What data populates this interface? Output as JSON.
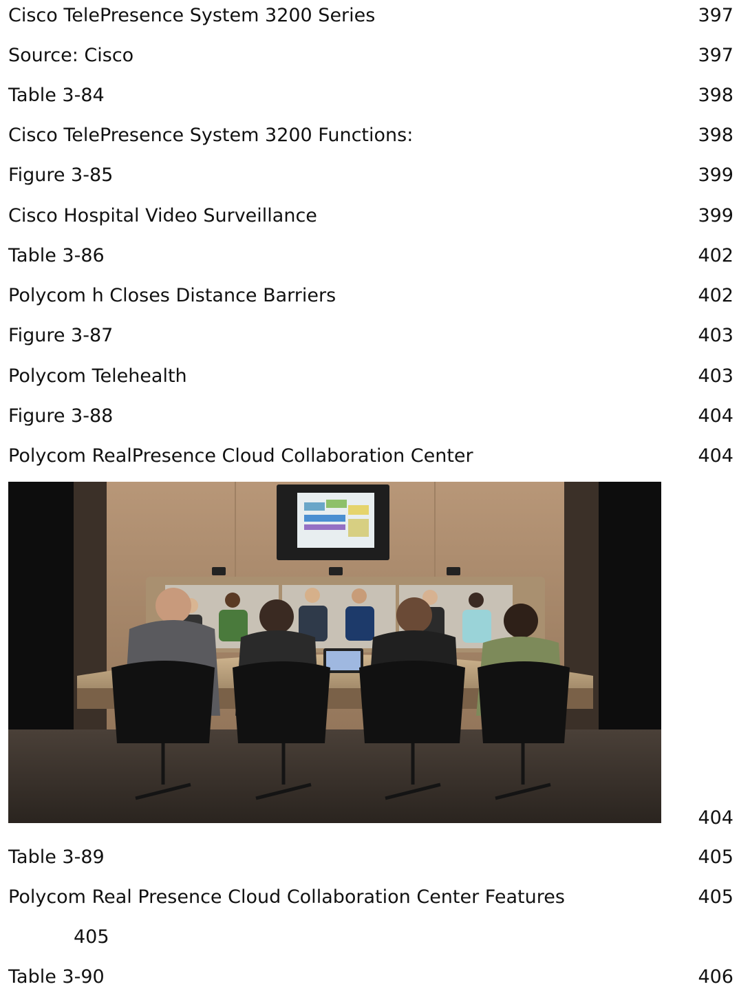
{
  "toc": {
    "entries_top": [
      {
        "label": "Cisco TelePresence System 3200 Series",
        "page": "397"
      },
      {
        "label": "Source: Cisco",
        "page": "397"
      },
      {
        "label": "Table 3-84",
        "page": "398"
      },
      {
        "label": "Cisco TelePresence System 3200 Functions:",
        "page": "398"
      },
      {
        "label": "Figure 3-85",
        "page": "399"
      },
      {
        "label": "Cisco Hospital Video Surveillance",
        "page": "399"
      },
      {
        "label": "Table 3-86",
        "page": "402"
      },
      {
        "label": "Polycom h Closes Distance Barriers",
        "page": "402"
      },
      {
        "label": "Figure 3-87",
        "page": "403"
      },
      {
        "label": "Polycom Telehealth",
        "page": "403"
      },
      {
        "label": "Figure 3-88",
        "page": "404"
      },
      {
        "label": "Polycom RealPresence Cloud Collaboration Center",
        "page": "404"
      }
    ],
    "image_page": "404",
    "entries_bottom": [
      {
        "label": "Table 3-89",
        "page": "405"
      },
      {
        "label": "Polycom Real Presence Cloud Collaboration Center Features",
        "page": "405"
      }
    ],
    "indented_page": "405",
    "last_entry": {
      "label": "Table 3-90",
      "page": "406"
    }
  }
}
